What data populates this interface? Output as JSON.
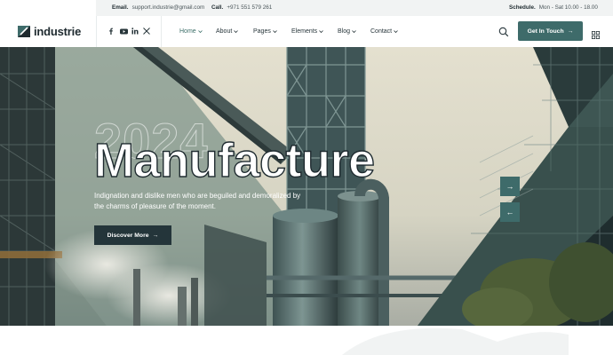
{
  "topbar": {
    "email_label": "Email.",
    "email_value": "support.industrie@gmail.com",
    "call_label": "Call.",
    "call_value": "+971 551 579 261",
    "schedule_label": "Schedule.",
    "schedule_value": "Mon - Sat 10.00 - 18.00"
  },
  "header": {
    "logo_text": "industrie",
    "social_icons": [
      "facebook-icon",
      "youtube-icon",
      "linkedin-icon",
      "x-icon"
    ],
    "nav": [
      {
        "label": "Home",
        "active": true
      },
      {
        "label": "About",
        "active": false
      },
      {
        "label": "Pages",
        "active": false
      },
      {
        "label": "Elements",
        "active": false
      },
      {
        "label": "Blog",
        "active": false
      },
      {
        "label": "Contact",
        "active": false
      }
    ],
    "cta_label": "Get In Touch",
    "cta_icon": "arrow-right-icon",
    "search_icon": "search-icon",
    "menu_icon": "grid-menu-icon"
  },
  "hero": {
    "year": "2024",
    "title": "Manufacture",
    "description": "Indignation and dislike men who are beguiled and demoralized by the charms of pleasure of the moment.",
    "button_label": "Discover More",
    "button_icon": "arrow-right-icon",
    "next_icon": "arrow-right-icon",
    "prev_icon": "arrow-left-icon"
  },
  "colors": {
    "accent": "#3e6b6a",
    "dark": "#24353a",
    "nav_active": "#3d6f69",
    "topbar_bg": "#f1f3f3"
  }
}
